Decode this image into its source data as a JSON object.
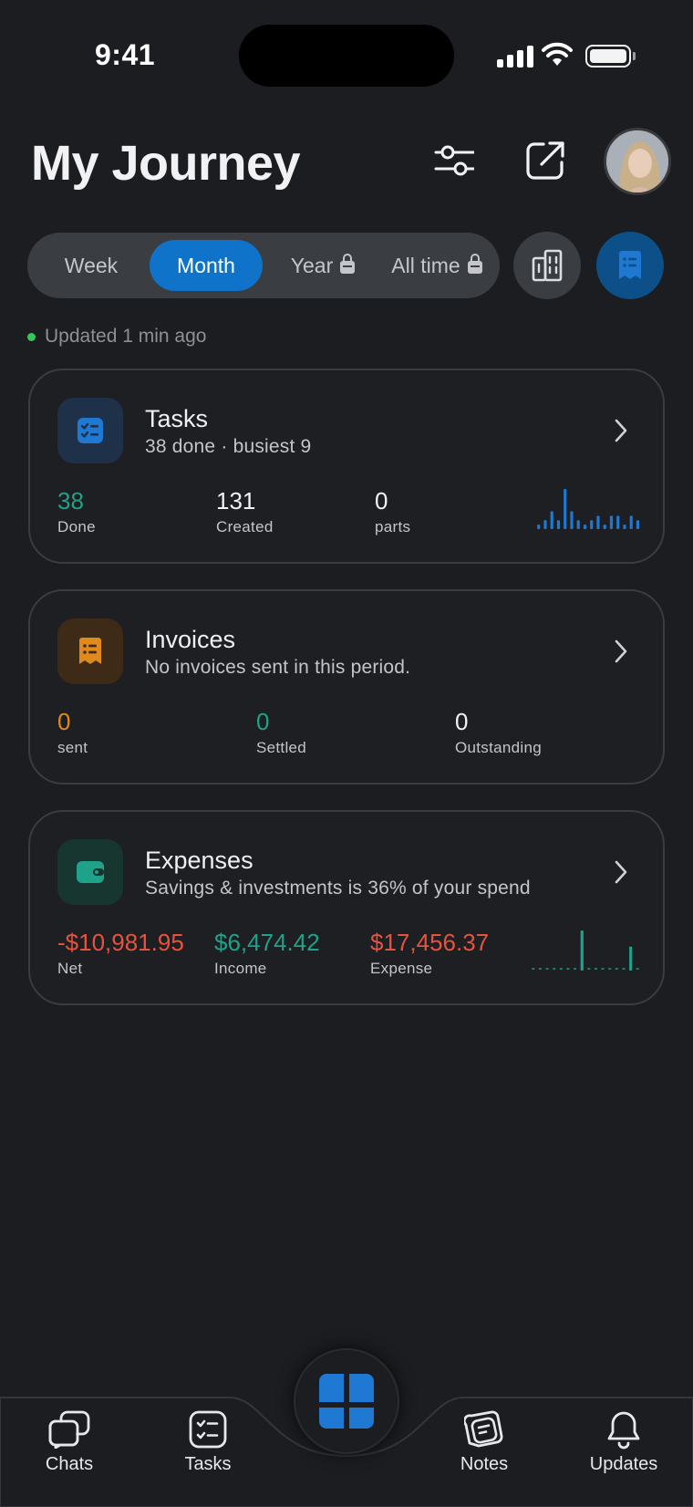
{
  "status_bar": {
    "time": "9:41"
  },
  "header": {
    "title": "My Journey"
  },
  "period_tabs": [
    {
      "label": "Week",
      "active": false,
      "locked": false
    },
    {
      "label": "Month",
      "active": true,
      "locked": false
    },
    {
      "label": "Year",
      "active": false,
      "locked": true
    },
    {
      "label": "All time",
      "active": false,
      "locked": true
    }
  ],
  "updated_text": "Updated 1 min ago",
  "cards": {
    "tasks": {
      "title": "Tasks",
      "subtitle": "38 done · busiest 9",
      "stats": [
        {
          "value": "38",
          "label": "Done"
        },
        {
          "value": "131",
          "label": "Created"
        },
        {
          "value": "0",
          "label": "parts"
        }
      ],
      "spark": [
        1,
        2,
        4,
        2,
        9,
        4,
        2,
        1,
        2,
        3,
        1,
        3,
        3,
        1,
        3,
        2
      ]
    },
    "invoices": {
      "title": "Invoices",
      "subtitle": "No invoices sent in this period.",
      "stats": [
        {
          "value": "0",
          "label": "sent"
        },
        {
          "value": "0",
          "label": "Settled"
        },
        {
          "value": "0",
          "label": "Outstanding"
        }
      ]
    },
    "expenses": {
      "title": "Expenses",
      "subtitle": "Savings & investments is 36% of your spend",
      "stats": [
        {
          "value": "-$10,981.95",
          "label": "Net"
        },
        {
          "value": "$6,474.42",
          "label": "Income"
        },
        {
          "value": "$17,456.37",
          "label": "Expense"
        }
      ],
      "spark": [
        0,
        0,
        0,
        0,
        0,
        0,
        0,
        10,
        0,
        0,
        0,
        0,
        0,
        0,
        6,
        0
      ]
    }
  },
  "tabbar": {
    "chats": "Chats",
    "tasks": "Tasks",
    "notes": "Notes",
    "updates": "Updates"
  },
  "colors": {
    "accent": "#0f73c9",
    "teal": "#1fa18a",
    "orange": "#e08a1e",
    "red": "#e5533d",
    "spark_blue": "#1f78d1"
  }
}
